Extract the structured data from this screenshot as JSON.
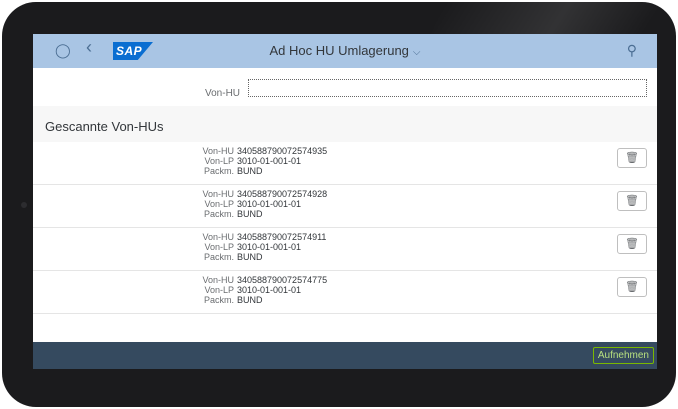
{
  "header": {
    "title": "Ad Hoc HU Umlagerung",
    "logo_text": "SAP",
    "icons": [
      "user-icon",
      "back-icon",
      "search-icon",
      "chevron-down-icon"
    ]
  },
  "form": {
    "von_hu_label": "Von-HU",
    "von_hu_value": ""
  },
  "section": {
    "title": "Gescannte Von-HUs"
  },
  "labels": {
    "hu": "Von-HU",
    "lp": "Von-LP",
    "packm": "Packm."
  },
  "items": [
    {
      "hu": "340588790072574935",
      "lp": "3010-01-001-01",
      "packm": "BUND"
    },
    {
      "hu": "340588790072574928",
      "lp": "3010-01-001-01",
      "packm": "BUND"
    },
    {
      "hu": "340588790072574911",
      "lp": "3010-01-001-01",
      "packm": "BUND"
    },
    {
      "hu": "340588790072574775",
      "lp": "3010-01-001-01",
      "packm": "BUND"
    }
  ],
  "footer": {
    "action_label": "Aufnehmen"
  },
  "colors": {
    "shellbar": "#a9c5e4",
    "footer": "#354a5f",
    "accept": "#7ab800"
  }
}
